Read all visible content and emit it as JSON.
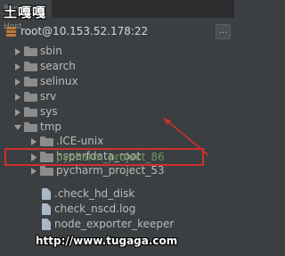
{
  "tab": {
    "label": "Remote Host"
  },
  "watermark_top": "土嘎嘎",
  "header": {
    "title": "root@10.153.52.178:22",
    "more_label": "..."
  },
  "tree": {
    "items": [
      {
        "label": "sbin",
        "type": "folder",
        "expanded": false
      },
      {
        "label": "search",
        "type": "folder",
        "expanded": false
      },
      {
        "label": "selinux",
        "type": "folder",
        "expanded": false
      },
      {
        "label": "srv",
        "type": "folder",
        "expanded": false
      },
      {
        "label": "sys",
        "type": "folder",
        "expanded": false
      },
      {
        "label": "tmp",
        "type": "folder",
        "expanded": true
      },
      {
        "label": ".ICE-unix",
        "type": "folder",
        "expanded": false
      },
      {
        "label": "hsperfdata_root",
        "type": "folder",
        "expanded": false
      },
      {
        "label": "pycharm_project_53",
        "type": "folder",
        "expanded": false
      },
      {
        "label": "pycharm_project_86",
        "type": "folder",
        "expanded": false,
        "highlighted": true
      },
      {
        "label": ".check_hd_disk",
        "type": "file"
      },
      {
        "label": "check_nscd.log",
        "type": "file"
      },
      {
        "label": "node_exporter_keeper",
        "type": "file"
      }
    ]
  },
  "watermark_bottom": "http://www.tugaga.com",
  "colors": {
    "highlight_border": "#d03030",
    "selected_text": "#6a9a5b",
    "background": "#3c3f41"
  }
}
